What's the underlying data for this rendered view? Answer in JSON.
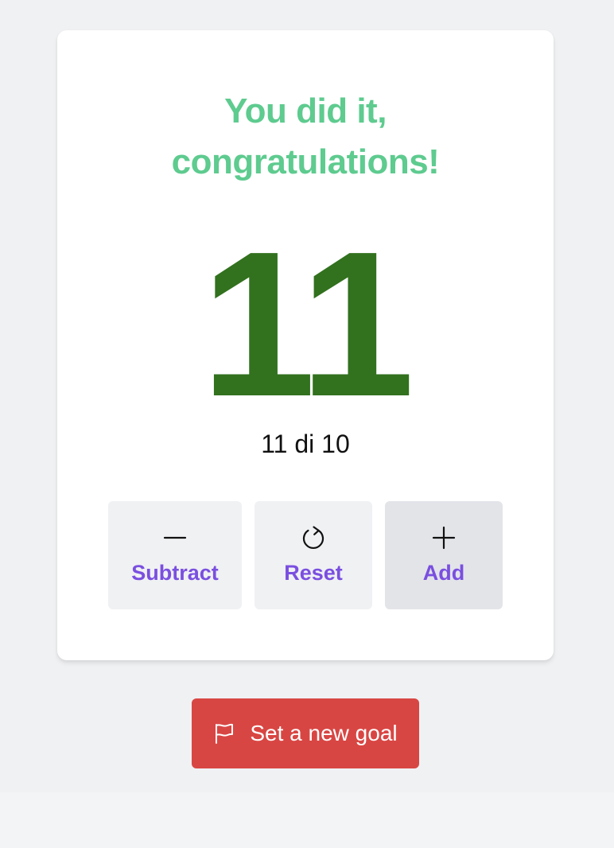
{
  "colors": {
    "headline": "#5ecb8f",
    "count": "#32711e",
    "button_label": "#7a4fe0",
    "goal_button": "#d84643"
  },
  "celebration": {
    "line1": "You did it,",
    "line2": "congratulations!"
  },
  "counter": {
    "value": "11",
    "progress_text": "11 di 10"
  },
  "controls": {
    "subtract": {
      "icon": "minus-icon",
      "label": "Subtract"
    },
    "reset": {
      "icon": "reset-icon",
      "label": "Reset"
    },
    "add": {
      "icon": "plus-icon",
      "label": "Add"
    }
  },
  "goal": {
    "icon": "flag-icon",
    "label": "Set a new goal"
  }
}
